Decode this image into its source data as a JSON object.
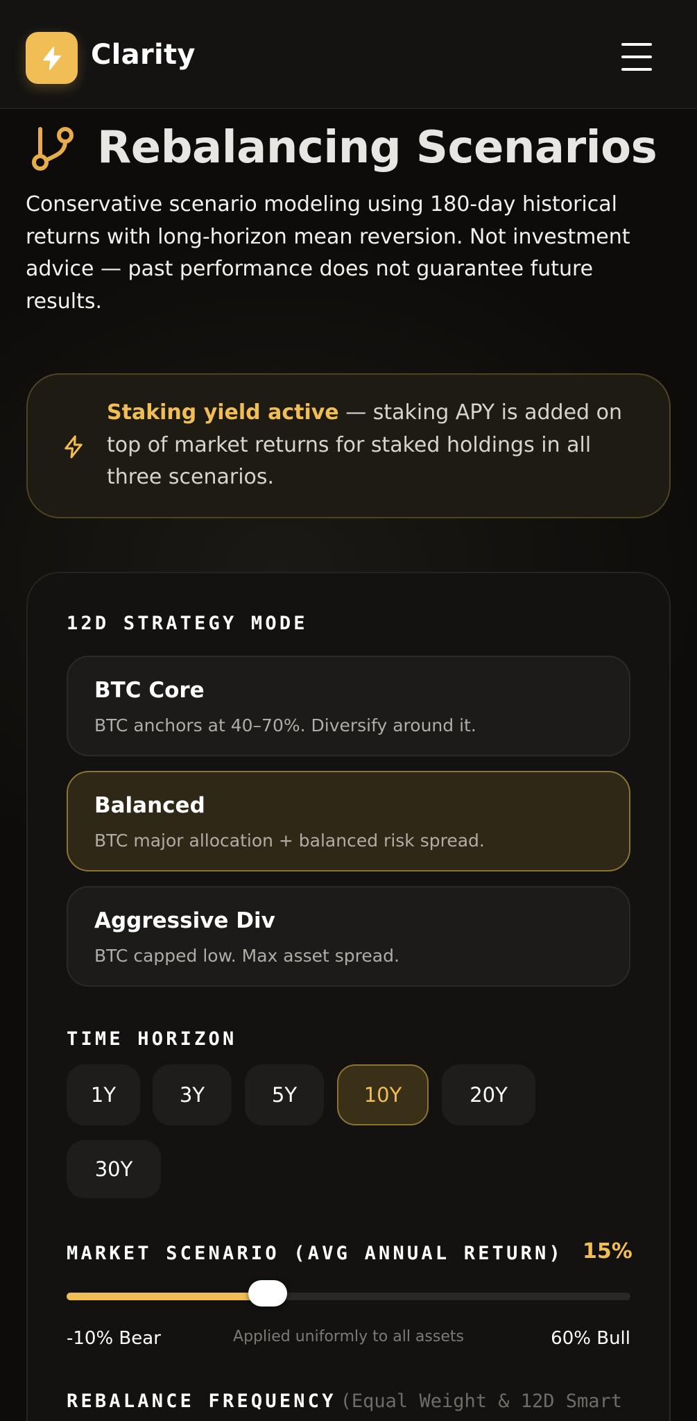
{
  "header": {
    "brand": "Clarity",
    "logo_icon": "lightning-bolt-icon",
    "menu_icon": "hamburger-menu-icon"
  },
  "page": {
    "title": "Rebalancing Scenarios",
    "title_icon": "git-branch-icon",
    "intro": "Conservative scenario modeling using 180-day historical returns with long-horizon mean reversion. Not investment advice — past performance does not guarantee future results."
  },
  "banner": {
    "icon": "lightning-bolt-icon",
    "strong": "Staking yield active",
    "text": " — staking APY is added on top of market returns for staked holdings in all three scenarios."
  },
  "strategy": {
    "label": "12D STRATEGY MODE",
    "options": [
      {
        "title": "BTC Core",
        "desc": "BTC anchors at 40–70%. Diversify around it.",
        "selected": false
      },
      {
        "title": "Balanced",
        "desc": "BTC major allocation + balanced risk spread.",
        "selected": true
      },
      {
        "title": "Aggressive Div",
        "desc": "BTC capped low. Max asset spread.",
        "selected": false
      }
    ]
  },
  "horizon": {
    "label": "TIME HORIZON",
    "options": [
      "1Y",
      "3Y",
      "5Y",
      "10Y",
      "20Y",
      "30Y"
    ],
    "selected": "10Y"
  },
  "scenario": {
    "label": "MARKET SCENARIO (AVG ANNUAL RETURN)",
    "value_label": "15%",
    "value": 15,
    "min": -10,
    "max": 60,
    "min_label": "-10% Bear",
    "max_label": "60% Bull",
    "note": "Applied uniformly to all assets"
  },
  "rebalance": {
    "label": "REBALANCE FREQUENCY",
    "note": "(Equal Weight & 12D Smart"
  },
  "colors": {
    "accent": "#f1bd55",
    "background": "#0d0c0a",
    "card": "#131210",
    "selected_bg": "#302817",
    "selected_border": "#8c7434"
  }
}
